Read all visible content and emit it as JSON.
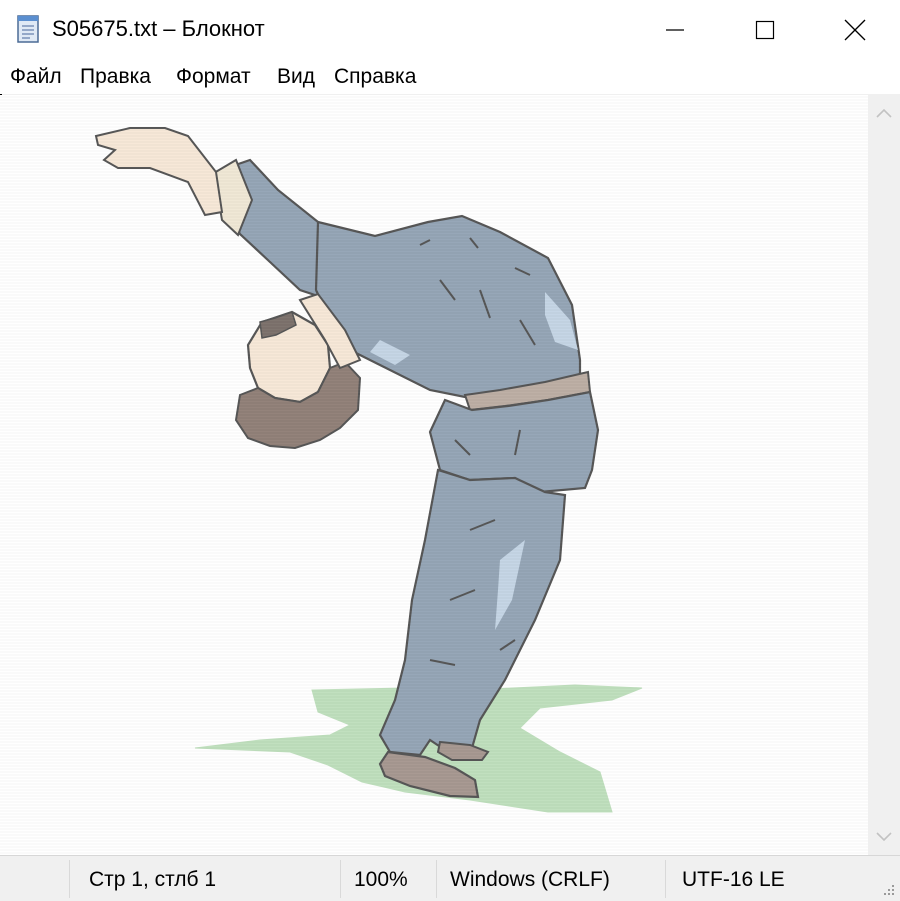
{
  "window": {
    "title": "S05675.txt – Блокнот",
    "icon": "notepad-icon"
  },
  "controls": {
    "minimize": "minimize-icon",
    "maximize": "maximize-icon",
    "close": "close-icon"
  },
  "menu": {
    "file": "Файл",
    "edit": "Правка",
    "format": "Формат",
    "view": "Вид",
    "help": "Справка"
  },
  "editor": {
    "content": "ascii-art-man-bending-backwards"
  },
  "status": {
    "position": "Стр 1, стлб 1",
    "zoom": "100%",
    "line_endings": "Windows (CRLF)",
    "encoding": "UTF-16 LE"
  },
  "colors": {
    "suit": "#5f7891",
    "skin": "#f2dcc3",
    "hair": "#5a4034",
    "grass": "#9fcf9c",
    "belt": "#9b8676",
    "shoe": "#7a6459"
  }
}
